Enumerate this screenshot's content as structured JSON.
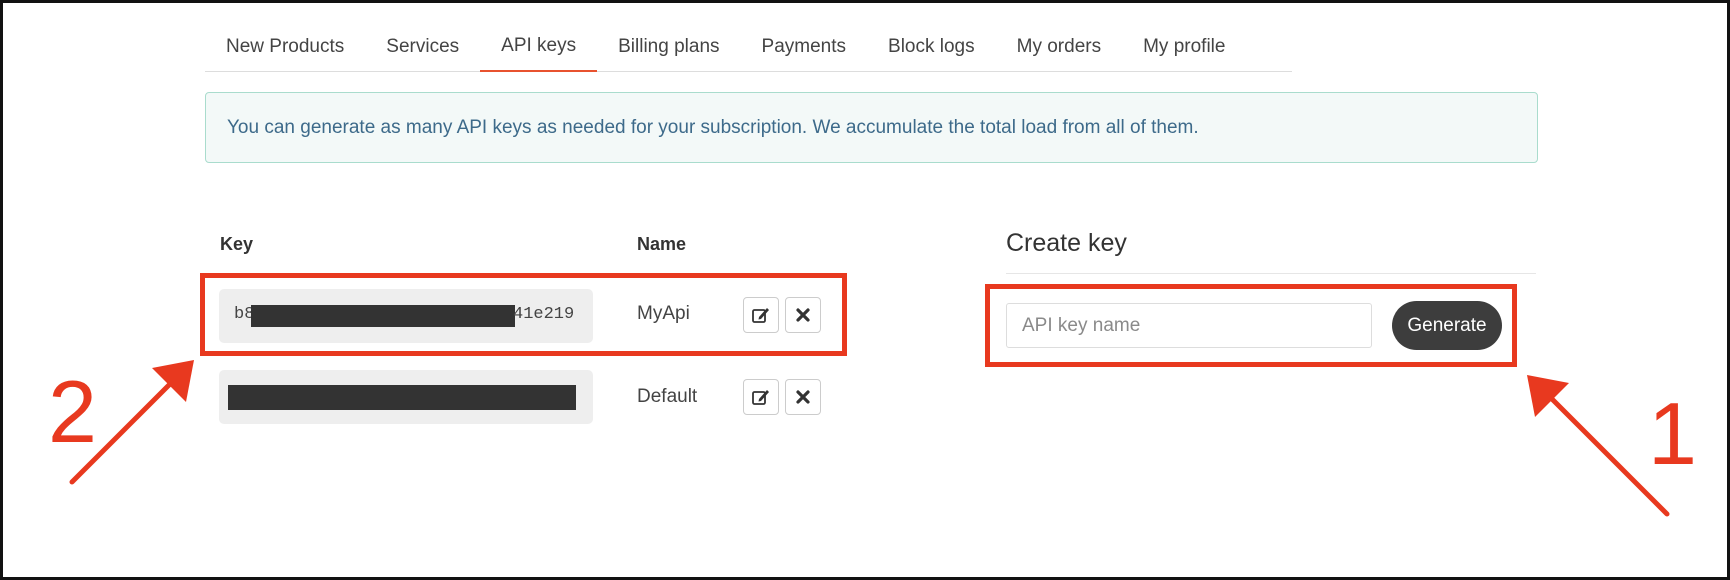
{
  "tabs": [
    {
      "label": "New Products",
      "active": false
    },
    {
      "label": "Services",
      "active": false
    },
    {
      "label": "API keys",
      "active": true
    },
    {
      "label": "Billing plans",
      "active": false
    },
    {
      "label": "Payments",
      "active": false
    },
    {
      "label": "Block logs",
      "active": false
    },
    {
      "label": "My orders",
      "active": false
    },
    {
      "label": "My profile",
      "active": false
    }
  ],
  "alert": {
    "text": "You can generate as many API keys as needed for your subscription. We accumulate the total load from all of them."
  },
  "keys_table": {
    "headers": {
      "key": "Key",
      "name": "Name"
    },
    "rows": [
      {
        "key_prefix": "b8",
        "key_suffix": "41e219",
        "name": "MyApi"
      },
      {
        "key_prefix": "",
        "key_suffix": "",
        "name": "Default"
      }
    ]
  },
  "create_key": {
    "title": "Create key",
    "input_value": "",
    "input_placeholder": "API key name",
    "button_label": "Generate"
  },
  "annotations": {
    "callout_1": "1",
    "callout_2": "2"
  },
  "colors": {
    "accent": "#e8522f",
    "annotation_red": "#e8391f",
    "alert_text": "#3d6a8a",
    "alert_bg": "#f3f9f8",
    "button_bg": "#3d3d3d"
  },
  "icons": [
    "edit-icon",
    "close-icon"
  ]
}
